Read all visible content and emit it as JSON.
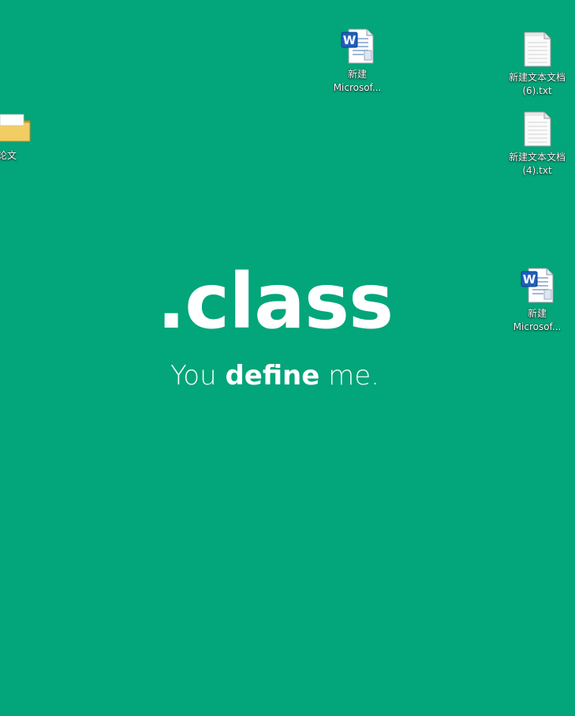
{
  "desktop": {
    "background_color": "#03a57a",
    "icons": [
      {
        "type": "word-document-icon",
        "label": "新建\nMicrosof..."
      },
      {
        "type": "text-file-icon",
        "label": "新建文本文档\n(6).txt"
      },
      {
        "type": "text-file-icon",
        "label": "新建文本文档\n(4).txt"
      },
      {
        "type": "word-document-icon",
        "label": "新建\nMicrosof..."
      },
      {
        "type": "folder-icon",
        "label": "论文"
      }
    ]
  },
  "wallpaper": {
    "title": ".class",
    "tagline_start": "You ",
    "tagline_bold": "define",
    "tagline_end": " me."
  }
}
